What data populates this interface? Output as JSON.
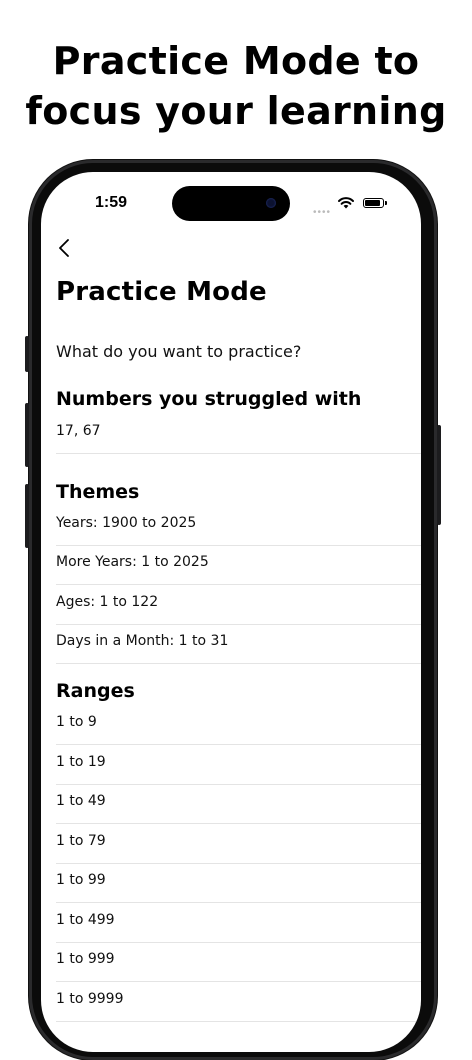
{
  "headline": {
    "line1": "Practice Mode to",
    "line2": "focus your learning"
  },
  "status_bar": {
    "time": "1:59"
  },
  "page": {
    "title": "Practice Mode",
    "prompt": "What do you want to practice?"
  },
  "struggled": {
    "title": "Numbers you struggled with",
    "value": "17, 67"
  },
  "themes": {
    "title": "Themes",
    "items": [
      "Years: 1900 to 2025",
      "More Years: 1 to 2025",
      "Ages: 1 to 122",
      "Days in a Month: 1 to 31"
    ]
  },
  "ranges": {
    "title": "Ranges",
    "items": [
      "1 to 9",
      "1 to 19",
      "1 to 49",
      "1 to 79",
      "1 to 99",
      "1 to 499",
      "1 to 999",
      "1 to 9999"
    ]
  }
}
